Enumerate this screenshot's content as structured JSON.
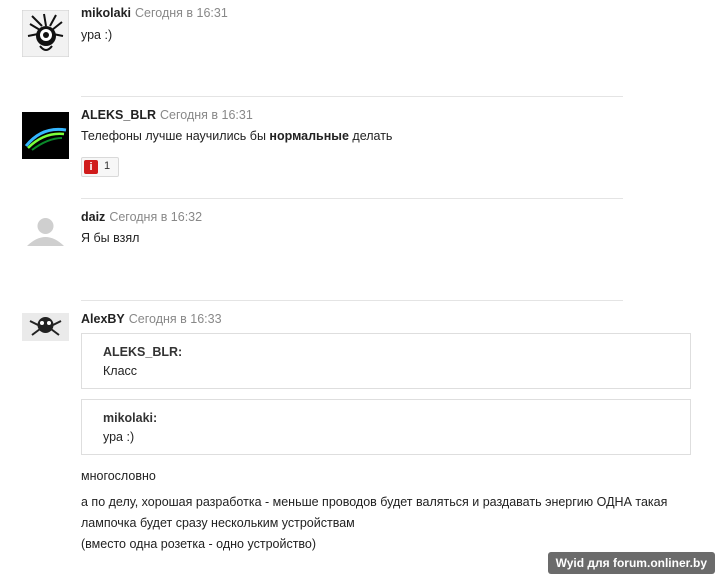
{
  "posts": [
    {
      "author": "mikolaki",
      "time": "Сегодня в 16:31",
      "text": "ура :)"
    },
    {
      "author": "ALEKS_BLR",
      "time": "Сегодня в 16:31",
      "text_before": "Телефоны лучше научились бы ",
      "text_bold": "нормальные",
      "text_after": " делать",
      "rating_count": "1"
    },
    {
      "author": "daiz",
      "time": "Сегодня в 16:32",
      "text": "Я бы взял"
    },
    {
      "author": "AlexBY",
      "time": "Сегодня в 16:33",
      "quotes": [
        {
          "author": "ALEKS_BLR:",
          "text": "Класс"
        },
        {
          "author": "mikolaki:",
          "text": "ура :)"
        }
      ],
      "lines": [
        "многословно",
        "а по делу, хорошая разработка - меньше проводов будет валяться и раздавать энергию ОДНА такая",
        "лампочка будет сразу нескольким устройствам",
        "(вместо одна розетка - одно устройство)"
      ]
    }
  ],
  "watermark": "Wyid для forum.onliner.by",
  "colors": {
    "accent_red": "#d01b1b",
    "divider": "#e4e4e4",
    "time_gray": "#888888"
  }
}
